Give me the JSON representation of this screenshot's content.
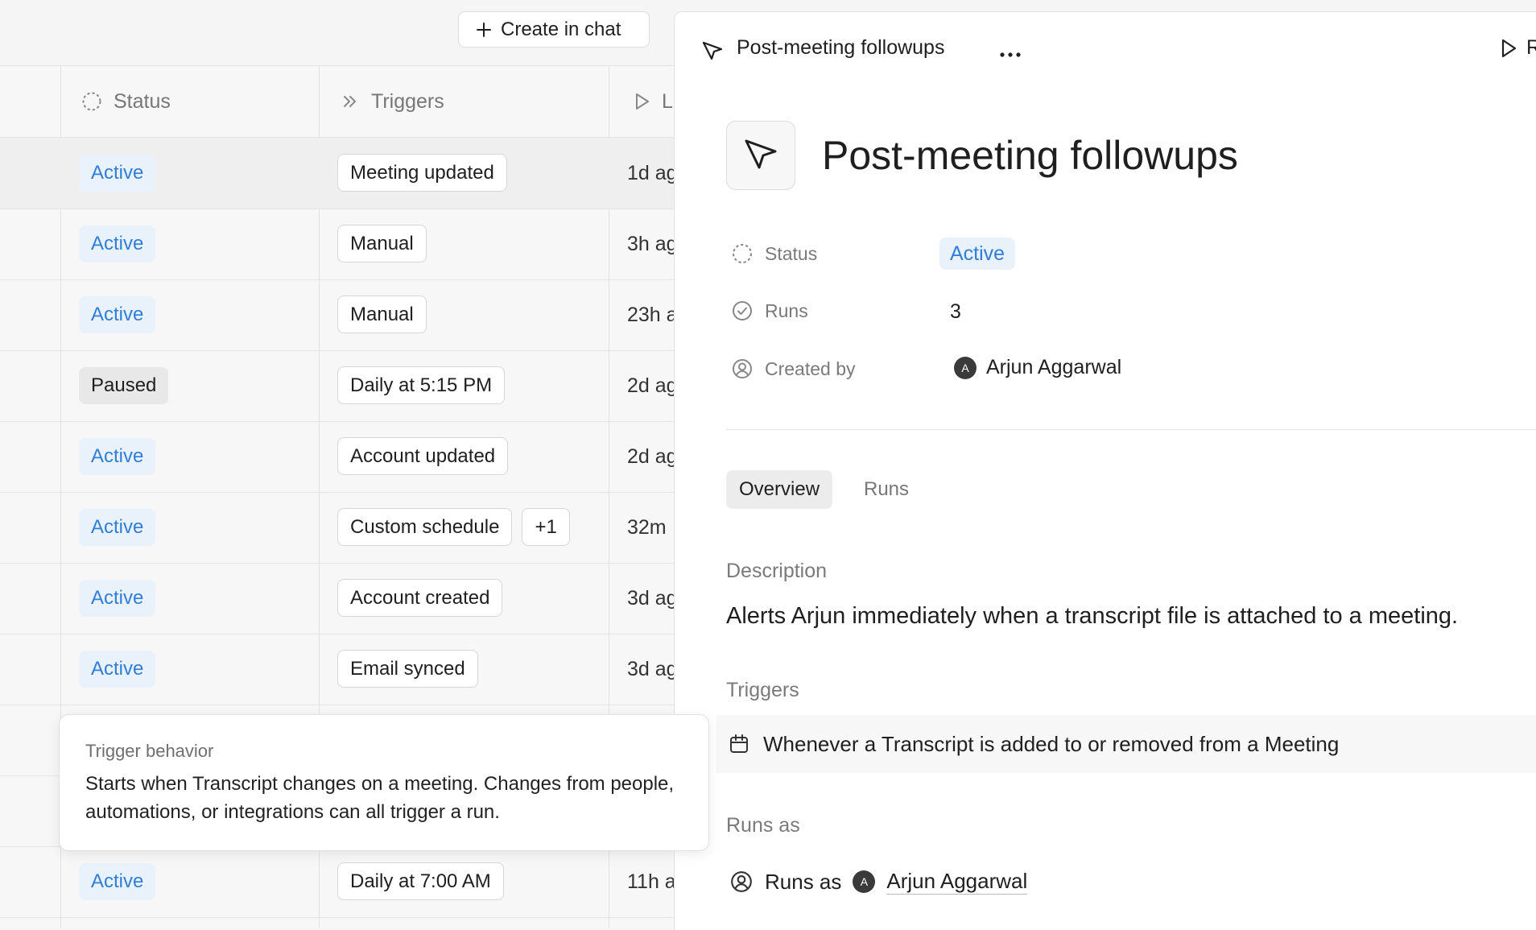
{
  "toolbar": {
    "create_label": "Create in chat"
  },
  "table": {
    "columns": {
      "status": "Status",
      "triggers": "Triggers",
      "last": "L"
    },
    "rows": [
      {
        "status": "Active",
        "triggers": [
          "Meeting updated"
        ],
        "last": "1d ag"
      },
      {
        "status": "Active",
        "triggers": [
          "Manual"
        ],
        "last": "3h ag"
      },
      {
        "status": "Active",
        "triggers": [
          "Manual"
        ],
        "last": "23h a"
      },
      {
        "status": "Paused",
        "triggers": [
          "Daily at 5:15 PM"
        ],
        "last": "2d ag"
      },
      {
        "status": "Active",
        "triggers": [
          "Account updated"
        ],
        "last": "2d ag"
      },
      {
        "status": "Active",
        "triggers": [
          "Custom schedule",
          "+1"
        ],
        "last": "32m"
      },
      {
        "status": "Active",
        "triggers": [
          "Account created"
        ],
        "last": "3d ag"
      },
      {
        "status": "Active",
        "triggers": [
          "Email synced"
        ],
        "last": "3d ag"
      },
      {
        "status": "",
        "triggers": [],
        "last": ""
      },
      {
        "status": "",
        "triggers": [],
        "last": ""
      },
      {
        "status": "Active",
        "triggers": [
          "Daily at 7:00 AM"
        ],
        "last": "11h a"
      }
    ]
  },
  "tooltip": {
    "title": "Trigger behavior",
    "body": "Starts when Transcript changes on a meeting. Changes from people, automations, or integrations can all trigger a run."
  },
  "panel": {
    "top_title": "Post-meeting followups",
    "title": "Post-meeting followups",
    "run_label_partial": "R",
    "props": {
      "status_label": "Status",
      "status_value": "Active",
      "runs_label": "Runs",
      "runs_value": "3",
      "created_label": "Created by",
      "created_value": "Arjun Aggarwal",
      "created_initial": "A"
    },
    "tabs": {
      "overview": "Overview",
      "runs": "Runs"
    },
    "description_label": "Description",
    "description": "Alerts Arjun immediately when a transcript file is attached to a meeting.",
    "triggers_label": "Triggers",
    "trigger_text": "Whenever a Transcript is added to or removed from a Meeting",
    "runs_as_label": "Runs as",
    "runs_as_prefix": "Runs as",
    "runs_as_name": "Arjun Aggarwal",
    "runs_as_initial": "A"
  },
  "colors": {
    "accent": "#2f7ed8",
    "active_bg": "#e9f1fb",
    "paused_bg": "#e8e8e8"
  },
  "icons": [
    "plus-icon",
    "dashed-circle-icon",
    "chevrons-right-icon",
    "play-icon",
    "cursor-arrow-icon",
    "more-icon",
    "check-circle-icon",
    "user-circle-icon",
    "calendar-icon"
  ]
}
